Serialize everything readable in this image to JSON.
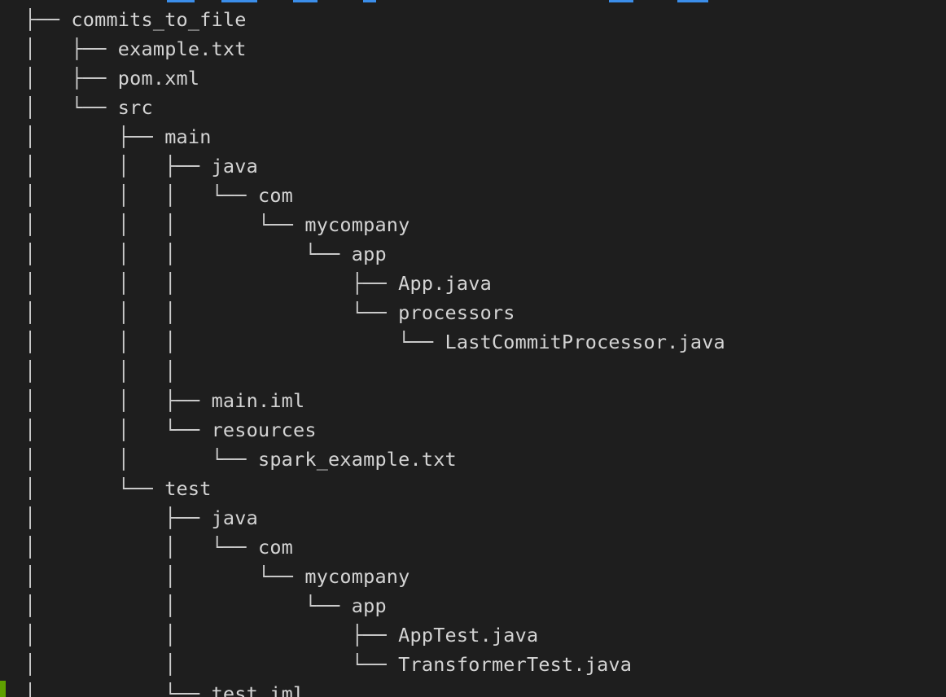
{
  "terminal": {
    "accent_color": "#3b8eea",
    "cursor_color": "#5fa000"
  },
  "tree": [
    {
      "prefix": "├── ",
      "name": "commits_to_file"
    },
    {
      "prefix": "│   ├── ",
      "name": "example.txt"
    },
    {
      "prefix": "│   ├── ",
      "name": "pom.xml"
    },
    {
      "prefix": "│   └── ",
      "name": "src"
    },
    {
      "prefix": "│       ├── ",
      "name": "main"
    },
    {
      "prefix": "│       │   ├── ",
      "name": "java"
    },
    {
      "prefix": "│       │   │   └── ",
      "name": "com"
    },
    {
      "prefix": "│       │   │       └── ",
      "name": "mycompany"
    },
    {
      "prefix": "│       │   │           └── ",
      "name": "app"
    },
    {
      "prefix": "│       │   │               ├── ",
      "name": "App.java"
    },
    {
      "prefix": "│       │   │               └── ",
      "name": "processors"
    },
    {
      "prefix": "│       │   │                   └── ",
      "name": "LastCommitProcessor.java"
    },
    {
      "prefix": "│       │   │",
      "name": ""
    },
    {
      "prefix": "│       │   ├── ",
      "name": "main.iml"
    },
    {
      "prefix": "│       │   └── ",
      "name": "resources"
    },
    {
      "prefix": "│       │       └── ",
      "name": "spark_example.txt"
    },
    {
      "prefix": "│       └── ",
      "name": "test"
    },
    {
      "prefix": "│           ├── ",
      "name": "java"
    },
    {
      "prefix": "│           │   └── ",
      "name": "com"
    },
    {
      "prefix": "│           │       └── ",
      "name": "mycompany"
    },
    {
      "prefix": "│           │           └── ",
      "name": "app"
    },
    {
      "prefix": "│           │               ├── ",
      "name": "AppTest.java"
    },
    {
      "prefix": "│           │               └── ",
      "name": "TransformerTest.java"
    },
    {
      "prefix": "│           └── ",
      "name": "test.iml"
    }
  ]
}
